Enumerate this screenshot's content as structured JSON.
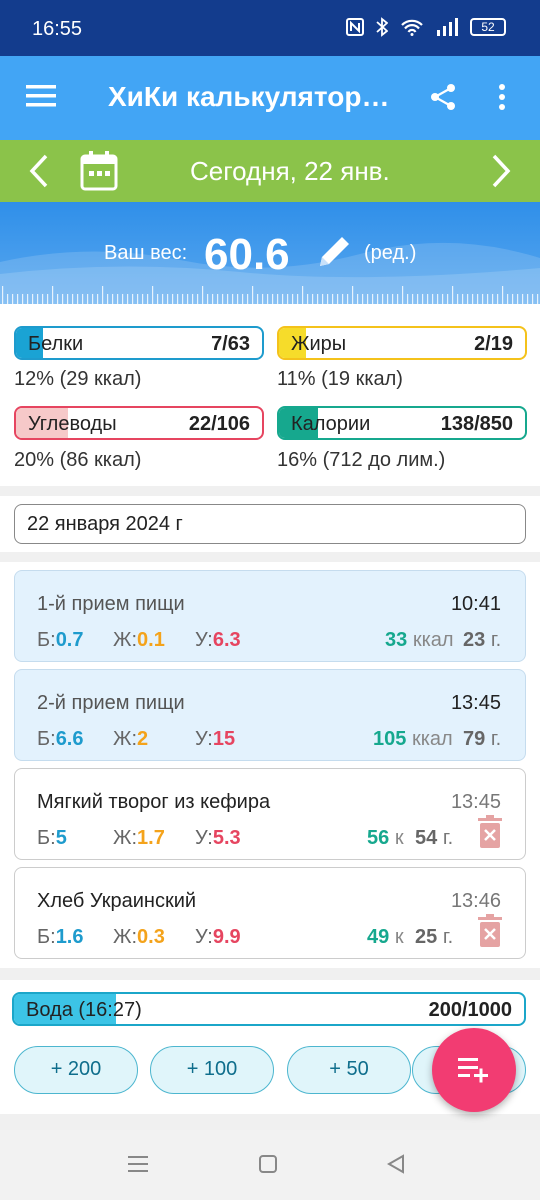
{
  "status_bar": {
    "time": "16:55",
    "battery": "52"
  },
  "app_bar": {
    "title": "ХиКи калькулятор…",
    "icons": [
      "menu-icon",
      "share-icon",
      "more-vert-icon"
    ]
  },
  "date_bar": {
    "label": "Сегодня, 22 янв."
  },
  "weight": {
    "label": "Ваш вес:",
    "value": "60.6",
    "edit_label": "(ред.)"
  },
  "nutrients": [
    {
      "name": "Белки",
      "value": "7/63",
      "sub_pct": "12%",
      "sub_detail": "(29 ккал)",
      "fill": 0.11,
      "color": "#1e9bcd"
    },
    {
      "name": "Жиры",
      "value": "2/19",
      "sub_pct": "11%",
      "sub_detail": "(19 ккал)",
      "fill": 0.11,
      "color": "#f4c21b"
    },
    {
      "name": "Углеводы",
      "value": "22/106",
      "sub_pct": "20%",
      "sub_detail": "(86 ккал)",
      "fill": 0.21,
      "color": "#e64560"
    },
    {
      "name": "Калории",
      "value": "138/850",
      "sub_pct": "16%",
      "sub_detail": "(712 до лим.)",
      "fill": 0.16,
      "color": "#16a88e"
    }
  ],
  "date_field": {
    "value": "22 января 2024 г"
  },
  "macro_labels": {
    "protein": "Б:",
    "fat": "Ж:",
    "carbs": "У:",
    "kcal_long": "ккал",
    "kcal_short": "к",
    "grams": "г."
  },
  "meals": [
    {
      "name": "1-й прием пищи",
      "time": "10:41",
      "protein": "0.7",
      "fat": "0.1",
      "carbs": "6.3",
      "kcal": "33",
      "grams": "23"
    },
    {
      "name": "2-й прием пищи",
      "time": "13:45",
      "protein": "6.6",
      "fat": "2",
      "carbs": "15",
      "kcal": "105",
      "grams": "79"
    },
    {
      "name": "Мягкий творог из кефира",
      "time": "13:45",
      "protein": "5",
      "fat": "1.7",
      "carbs": "5.3",
      "kcal": "56",
      "grams": "54"
    },
    {
      "name": "Хлеб Украинский",
      "time": "13:46",
      "protein": "1.6",
      "fat": "0.3",
      "carbs": "9.9",
      "kcal": "49",
      "grams": "25"
    }
  ],
  "water": {
    "label": "Вода (16:27)",
    "value": "200/1000",
    "fill": 0.2,
    "buttons": [
      "+ 200",
      "+ 100",
      "+ 50"
    ]
  },
  "colors": {
    "primary": "#42a5f5",
    "status": "#133c8d",
    "date_bar": "#8bc34a",
    "fab": "#f23c72"
  }
}
